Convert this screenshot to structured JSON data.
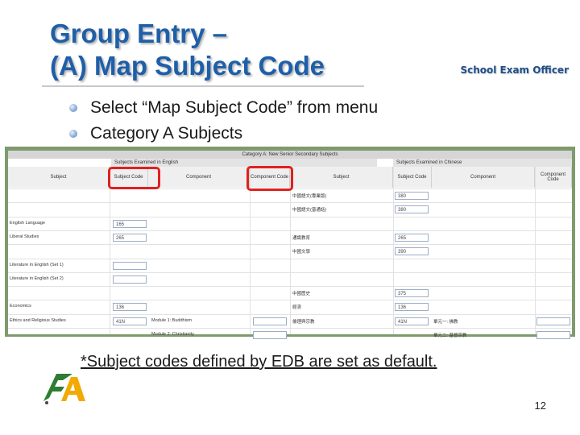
{
  "slide": {
    "title_line1": "Group Entry –",
    "title_line2": "(A) Map Subject Code",
    "brand": "School Exam Officer",
    "bullets": [
      "Select “Map Subject Code” from menu",
      "Category A Subjects"
    ],
    "note": "*Subject codes defined by EDB are set as default.",
    "page_number": "12"
  },
  "screenshot": {
    "caption": "Category A: New Senior Secondary Subjects",
    "group_english": "Subjects Examined in English",
    "group_chinese": "Subjects Examined in Chinese",
    "headers": [
      "Subject",
      "Subject Code",
      "Component",
      "Component Code",
      "Subject",
      "Subject Code",
      "Component",
      "Component Code"
    ],
    "rows": [
      {
        "en_subject": "",
        "en_code": "",
        "en_component": "",
        "cn_subject": "中國語文(專業版)",
        "cn_code": "380",
        "cn_component": ""
      },
      {
        "en_subject": "",
        "en_code": "",
        "en_component": "",
        "cn_subject": "中國語文(普通話)",
        "cn_code": "380",
        "cn_component": ""
      },
      {
        "en_subject": "English Language",
        "en_code": "165",
        "en_component": "",
        "cn_subject": "",
        "cn_code": "",
        "cn_component": ""
      },
      {
        "en_subject": "Liberal Studies",
        "en_code": "265",
        "en_component": "",
        "cn_subject": "通識教育",
        "cn_code": "265",
        "cn_component": ""
      },
      {
        "en_subject": "",
        "en_code": "",
        "en_component": "",
        "cn_subject": "中國文學",
        "cn_code": "390",
        "cn_component": ""
      },
      {
        "en_subject": "Literature in English (Set 1)",
        "en_code": "",
        "en_component": "",
        "cn_subject": "",
        "cn_code": "",
        "cn_component": ""
      },
      {
        "en_subject": "Literature in English (Set 2)",
        "en_code": "",
        "en_component": "",
        "cn_subject": "",
        "cn_code": "",
        "cn_component": ""
      },
      {
        "en_subject": "",
        "en_code": "",
        "en_component": "",
        "cn_subject": "中國歷史",
        "cn_code": "375",
        "cn_component": ""
      },
      {
        "en_subject": "Economics",
        "en_code": "136",
        "en_component": "",
        "cn_subject": "經濟",
        "cn_code": "136",
        "cn_component": ""
      },
      {
        "en_subject": "Ethics and Religious Studies",
        "en_code": "41N",
        "en_component": "Module 1: Buddhism",
        "cn_subject": "倫理與宗教",
        "cn_code": "41N",
        "cn_component": "單元一: 佛教"
      },
      {
        "en_subject": "",
        "en_code": "",
        "en_component": "Module 2: Christianity",
        "cn_subject": "",
        "cn_code": "",
        "cn_component": "單元二: 基督宗教"
      }
    ]
  }
}
